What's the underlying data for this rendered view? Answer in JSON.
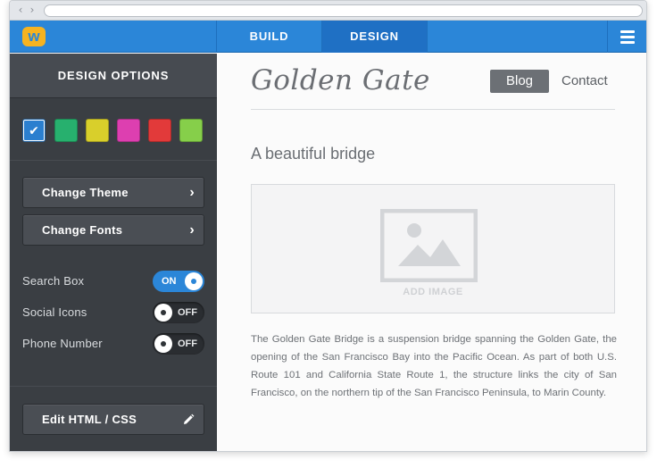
{
  "topbar": {
    "logo_letter": "w",
    "tabs": [
      {
        "label": "BUILD",
        "active": false
      },
      {
        "label": "DESIGN",
        "active": true
      }
    ]
  },
  "sidebar": {
    "title": "DESIGN OPTIONS",
    "swatches": [
      {
        "color": "#2b7fcf",
        "selected": true
      },
      {
        "color": "#27b06e",
        "selected": false
      },
      {
        "color": "#d9cf2b",
        "selected": false
      },
      {
        "color": "#dd3fb0",
        "selected": false
      },
      {
        "color": "#e23a3a",
        "selected": false
      },
      {
        "color": "#86cf4a",
        "selected": false
      }
    ],
    "buttons": {
      "change_theme": "Change Theme",
      "change_fonts": "Change Fonts",
      "edit_html": "Edit HTML / CSS"
    },
    "toggles": [
      {
        "label": "Search Box",
        "state": "ON"
      },
      {
        "label": "Social Icons",
        "state": "OFF"
      },
      {
        "label": "Phone Number",
        "state": "OFF"
      }
    ]
  },
  "site": {
    "title": "Golden Gate",
    "nav": {
      "blog": "Blog",
      "contact": "Contact"
    },
    "heading": "A beautiful bridge",
    "add_image": "ADD IMAGE",
    "body": "The Golden Gate Bridge is a suspension bridge spanning the Golden Gate, the opening of the San Francisco Bay into the Pacific Ocean. As part of both U.S. Route 101 and California State Route 1, the structure links the city of San Francisco, on the northern tip of the San Francisco Peninsula, to Marin County."
  },
  "colors": {
    "accent": "#2b86d8",
    "sidebar_bg": "#3a3e43"
  }
}
